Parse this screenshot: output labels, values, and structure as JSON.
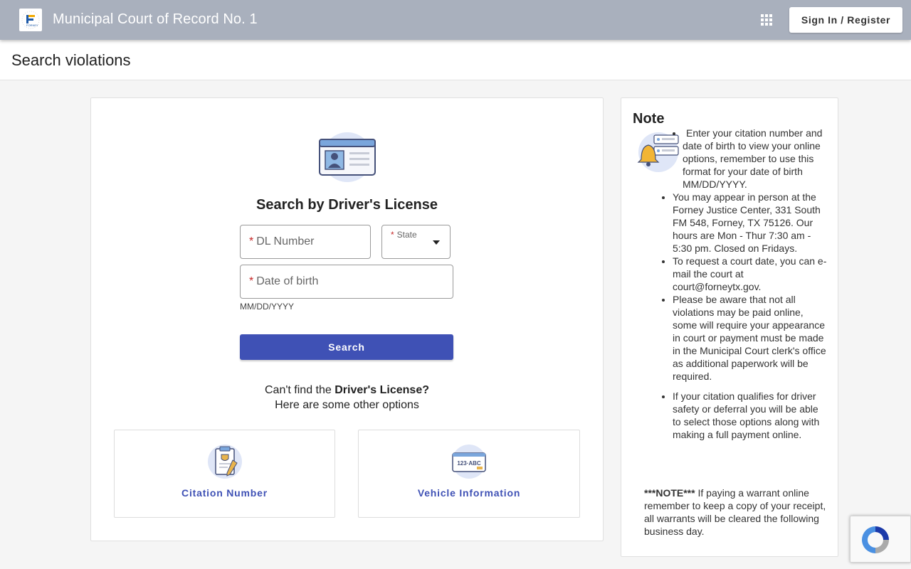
{
  "header": {
    "app_title": "Municipal Court of Record No. 1",
    "logo_alt": "FORNEY",
    "sign_in_label": "Sign In / Register"
  },
  "page": {
    "title": "Search violations"
  },
  "search": {
    "heading": "Search by Driver's License",
    "dl_placeholder": "DL Number",
    "state_label": "State",
    "dob_placeholder": "Date of birth",
    "dob_hint": "MM/DD/YYYY",
    "required_mark": "*",
    "button_label": "Search"
  },
  "alternatives": {
    "line1_prefix": "Can't find the ",
    "line1_bold": "Driver's License?",
    "line2": "Here are some other options",
    "citation_label": "Citation Number",
    "vehicle_label": "Vehicle Information",
    "vehicle_plate": "123·ABC"
  },
  "note": {
    "title": "Note",
    "items": [
      "Enter your citation number and date of birth to view your online options, remember to use this format for your date of birth MM/DD/YYYY.",
      "You may appear in person at the Forney Justice Center, 331 South FM 548, Forney, TX 75126.  Our hours are Mon - Thur 7:30 am - 5:30 pm. Closed on Fridays.",
      "To request a court date, you can e-mail the court at court@forneytx.gov.",
      "Please be aware that not all violations may be paid online, some will require your appearance in court or payment must be made in the Municipal Court clerk's office as additional paperwork will be required.",
      "If your citation qualifies for driver safety or deferral you will be able to select those options along with making a full payment online."
    ],
    "warning_bold": "***NOTE***",
    "warning_text": " If paying a warrant online remember to keep a copy of your receipt, all warrants will be cleared the following business day."
  },
  "colors": {
    "topbar": "#a9b0bd",
    "primary": "#3f51b5",
    "required": "#c62828"
  }
}
